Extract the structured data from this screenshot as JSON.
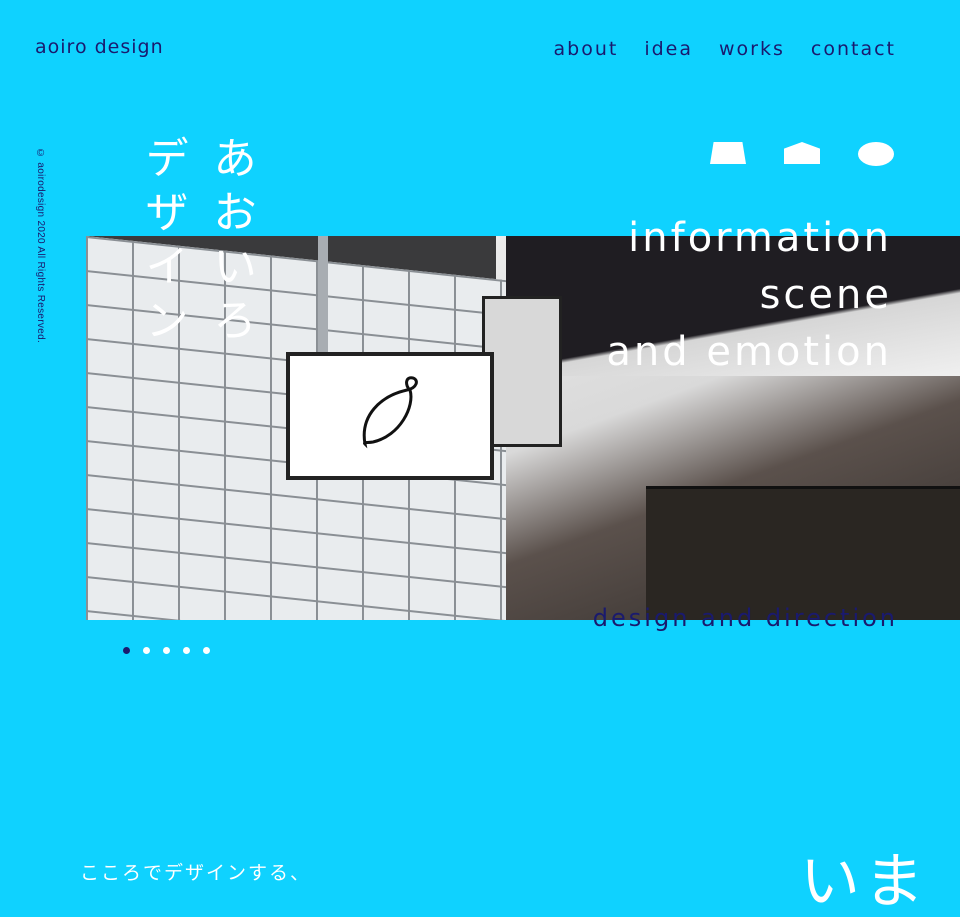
{
  "header": {
    "logo": "aoiro design",
    "nav": [
      "about",
      "idea",
      "works",
      "contact"
    ]
  },
  "copyright": "© aoirodesign 2020 All Rights Reserved.",
  "hero": {
    "jp_title_col1": "あおいろ",
    "jp_title_col2": "デザイン",
    "tagline": [
      "information",
      "scene",
      "and emotion"
    ],
    "subtitle": "design and direction",
    "slides_total": 5,
    "slide_active": 1
  },
  "section": {
    "lead": "こころでデザインする、",
    "big_text": "いま"
  },
  "colors": {
    "background": "#0fd2ff",
    "accent_navy": "#1a1a6e",
    "white": "#ffffff"
  },
  "icons": [
    "trapezoid-shape-icon",
    "house-shape-icon",
    "oval-shape-icon"
  ]
}
